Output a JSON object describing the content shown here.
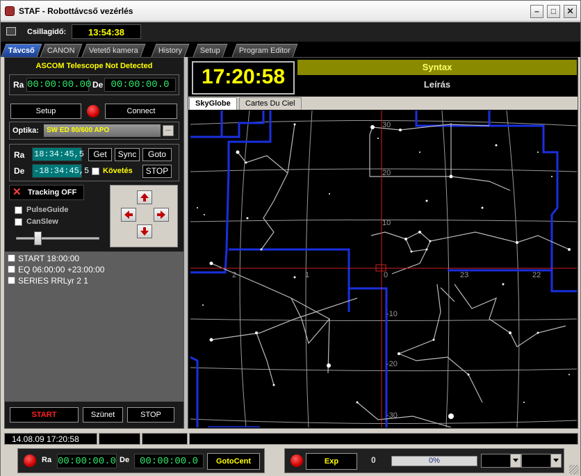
{
  "window": {
    "title": "STAF - Robottávcső vezérlés"
  },
  "sidereal": {
    "label": "Csillagidő:",
    "time": "13:54:38"
  },
  "tabs": [
    {
      "label": "Távcső"
    },
    {
      "label": "CANON"
    },
    {
      "label": "Vetető kamera"
    },
    {
      "label": "History"
    },
    {
      "label": "Setup"
    },
    {
      "label": "Program Editor"
    }
  ],
  "telescope": {
    "status": "ASCOM Telescope Not Detected",
    "ra_label": "Ra",
    "ra_value": "00:00:00.00",
    "de_label": "De",
    "de_value": "00:00:00.0",
    "setup_label": "Setup",
    "connect_label": "Connect",
    "optika_label": "Optika:",
    "optika_value": "SW ED 80/600 APO",
    "optika_browse": "...",
    "target_ra_label": "Ra",
    "target_ra": "18:34:45,5",
    "target_de_label": "De",
    "target_de": "-18:34:45,5",
    "get_label": "Get",
    "sync_label": "Sync",
    "goto_label": "Goto",
    "kovetes_label": "Követés",
    "stop_label": "STOP",
    "tracking_label": "Tracking OFF",
    "pulseguide_label": "PulseGuide",
    "canslew_label": "CanSlew",
    "slew_rate": 0.22
  },
  "sequence": [
    {
      "text": "START 18:00:00"
    },
    {
      "text": "EQ 06:00:00 +23:00:00"
    },
    {
      "text": "SERIES RRLyr 2 1"
    }
  ],
  "controls": {
    "start": "START",
    "pause": "Szünet",
    "stop": "STOP"
  },
  "right": {
    "clock": "17:20:58",
    "syntax_label": "Syntax",
    "leiras_label": "Leírás",
    "subtabs": [
      {
        "label": "SkyGlobe"
      },
      {
        "label": "Cartes Du Ciel"
      }
    ],
    "ra_ticks": [
      "2",
      "1",
      "0",
      "23",
      "22"
    ],
    "dec_ticks": [
      "30",
      "20",
      "10",
      "-10",
      "-20",
      "-30"
    ]
  },
  "status": {
    "datetime": "14.08.09 17:20:58"
  },
  "footer": {
    "ra_label": "Ra",
    "ra_value": "00:00:00.0",
    "de_label": "De",
    "de_value": "00:00:00.0",
    "gotocent_label": "GotoCent",
    "exp_label": "Exp",
    "exp_count": "0",
    "progress_text": "0%",
    "progress": 0
  },
  "colors": {
    "lcd_green": "#2fe86b",
    "clock_yellow": "#ffff00",
    "boundary_blue": "#1a2fe0",
    "crosshair_red": "#d02020"
  }
}
